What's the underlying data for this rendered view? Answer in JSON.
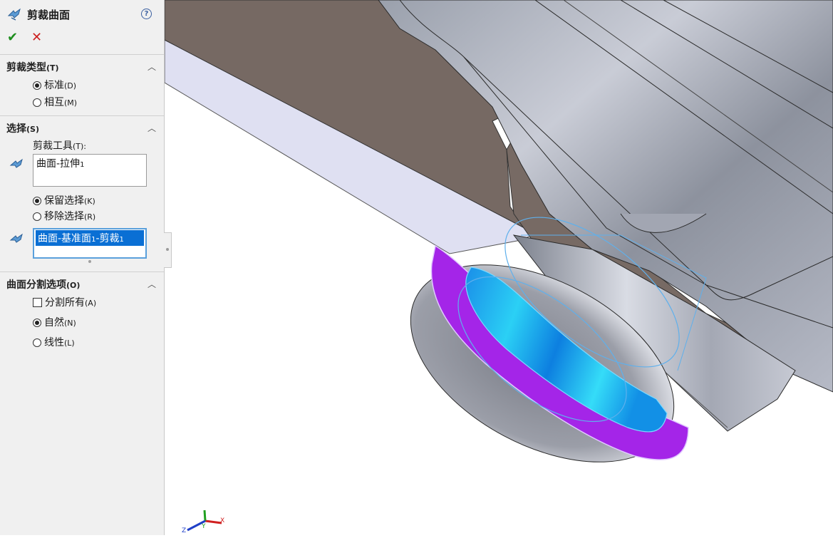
{
  "feature": {
    "title": "剪裁曲面",
    "help_label": "?",
    "ok_symbol": "✔",
    "cancel_symbol": "✕"
  },
  "trim_type": {
    "header": "剪裁类型",
    "header_key": "(T)",
    "options": [
      {
        "label": "标准",
        "key": "(D)",
        "selected": true
      },
      {
        "label": "相互",
        "key": "(M)",
        "selected": false
      }
    ]
  },
  "selections": {
    "header": "选择",
    "header_key": "(S)",
    "trim_tool_label": "剪裁工具",
    "trim_tool_key": "(T):",
    "trim_tool_value": "曲面-拉伸",
    "trim_tool_suffix": "1",
    "keep_label": "保留选择",
    "keep_key": "(K)",
    "remove_label": "移除选择",
    "remove_key": "(R)",
    "kept_item_a": "曲面-基准面",
    "kept_item_b": "1",
    "kept_item_c": "-剪裁",
    "kept_item_d": "1"
  },
  "split": {
    "header": "曲面分割选项",
    "header_key": "(O)",
    "split_all_label": "分割所有",
    "split_all_key": "(A)",
    "natural_label": "自然",
    "natural_key": "(N)",
    "linear_label": "线性",
    "linear_key": "(L)"
  },
  "triad": {
    "x": "X",
    "y": "Y",
    "z": "Z"
  },
  "colors": {
    "accent": "#0a6fd4",
    "ok": "#1e8e1e",
    "cancel": "#cc2020",
    "highlight_purple": "#a020f0",
    "highlight_blue": "#1aa8f0"
  }
}
